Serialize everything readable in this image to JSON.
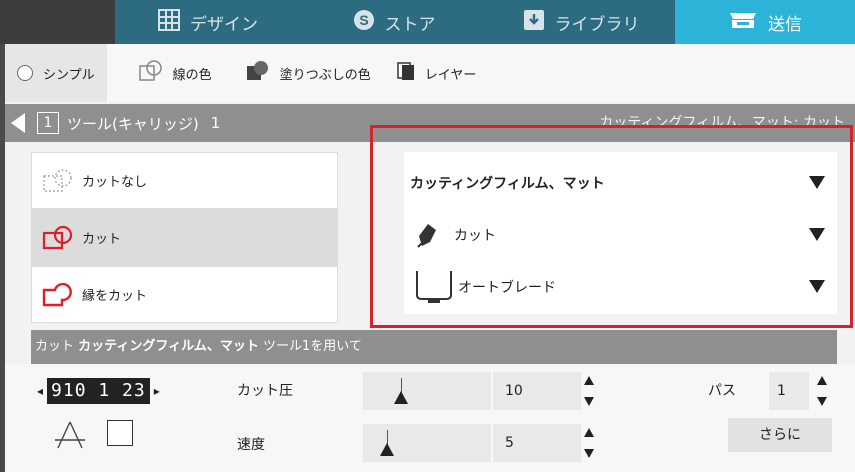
{
  "tabs": [
    {
      "label": "デザイン",
      "icon": "grid-icon"
    },
    {
      "label": "ストア",
      "icon": "store-s-icon"
    },
    {
      "label": "ライブラリ",
      "icon": "download-icon"
    },
    {
      "label": "送信",
      "icon": "cutter-icon"
    }
  ],
  "modes": {
    "simple": "シンプル",
    "line_color": "線の色",
    "fill_color": "塗りつぶしの色",
    "layer": "レイヤー"
  },
  "tool_header": {
    "tool_number": "1",
    "title": "ツール(キャリッジ)",
    "count": "1",
    "right_text": "カッティングフィルム、マット: カット"
  },
  "cut_options": [
    {
      "label": "カットなし",
      "selected": false
    },
    {
      "label": "カット",
      "selected": true
    },
    {
      "label": "縁をカット",
      "selected": false
    }
  ],
  "material": {
    "media": "カッティングフィルム、マット",
    "action": "カット",
    "tool": "オートブレード"
  },
  "info_bar": {
    "prefix": "カット",
    "material": "カッティングフィルム、マット",
    "suffix": "ツール1を用いて"
  },
  "blade_preview": {
    "digits": "910 1 23",
    "highlight": "1"
  },
  "settings": {
    "force_label": "カット圧",
    "force_value": "10",
    "speed_label": "速度",
    "speed_value": "5",
    "passes_label": "パス",
    "passes_value": "1",
    "more_button": "さらに"
  },
  "colors": {
    "accent": "#2bb3d8",
    "tab_bg": "#2d6c80",
    "highlight_border": "#d6232b"
  }
}
